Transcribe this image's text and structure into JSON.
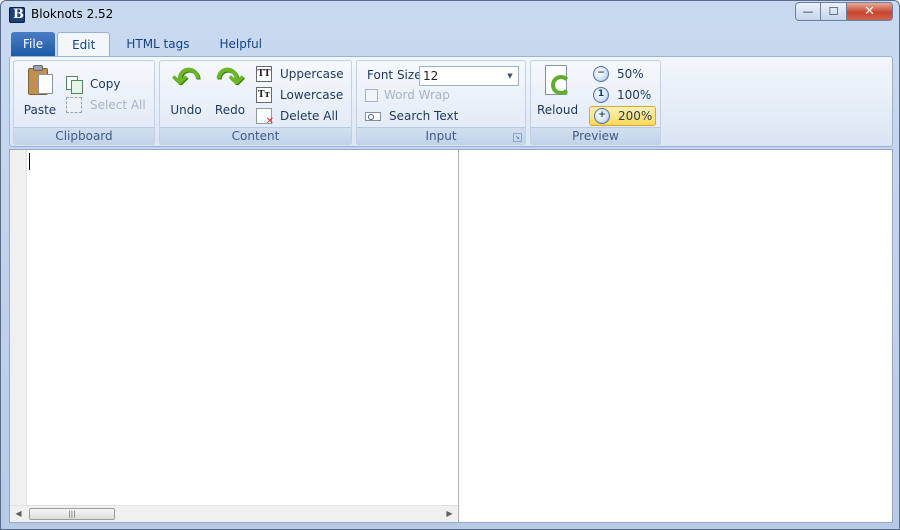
{
  "window": {
    "title": "Bloknots 2.52",
    "buttons": {
      "minimize": "—",
      "maximize": "☐",
      "close": "✕"
    }
  },
  "ribbon_tabs": [
    {
      "label": "File",
      "state": "file"
    },
    {
      "label": "Edit",
      "state": "active"
    },
    {
      "label": "HTML tags",
      "state": "normal"
    },
    {
      "label": "Helpful",
      "state": "normal"
    }
  ],
  "clipboard": {
    "label": "Clipboard",
    "paste": "Paste",
    "copy": "Copy",
    "select_all": "Select All"
  },
  "content": {
    "label": "Content",
    "undo": "Undo",
    "redo": "Redo",
    "uppercase": "Uppercase",
    "uppercase_icon_text": "TT",
    "lowercase": "Lowercase",
    "lowercase_icon_text": "Tт",
    "delete_all": "Delete All"
  },
  "input": {
    "label": "Input",
    "font_size_label": "Font Size",
    "font_size_value": "12",
    "word_wrap": "Word Wrap",
    "word_wrap_checked": false,
    "search_text": "Search Text"
  },
  "preview": {
    "label": "Preview",
    "reload": "Reloud",
    "zoom_50": "50%",
    "zoom_100": "100%",
    "zoom_200": "200%",
    "selected_zoom": "200%"
  },
  "editor": {
    "text": "",
    "scroll_thumb_grip": "|||"
  },
  "colors": {
    "ribbon_bg": "#dbe6f4",
    "file_tab": "#1d5aa5",
    "accent_text": "#15428b",
    "selected_zoom": "#ffd75c"
  }
}
